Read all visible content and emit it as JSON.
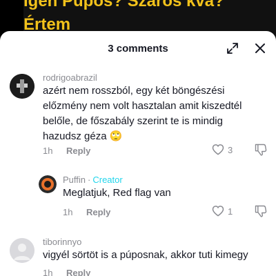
{
  "background": {
    "caption_line1": "Igen Pupos? Szaros kva?",
    "caption_line2": "Értem"
  },
  "sheet": {
    "title": "3 comments"
  },
  "comments": [
    {
      "username": "rodrigoabrazil",
      "text": "azért nem rosszból, egy két böngészési előzmény nem volt hasztalan amit kiszedtél belőle, de főszabály szerint te is mindig hazudsz géza 🙄",
      "time": "1h",
      "reply_label": "Reply",
      "likes": "3"
    },
    {
      "username": "Puffin",
      "creator_label": "Creator",
      "separator": "·",
      "text": "Meglatjuk, Red flag van",
      "time": "1h",
      "reply_label": "Reply",
      "likes": "1"
    },
    {
      "username": "tiborinnyo",
      "text": "vigyél sörtöt is a púposnak, akkor tuti kimegy",
      "time": "1h",
      "reply_label": "Reply"
    }
  ],
  "colors": {
    "caption": "#f2c21b",
    "creator": "#20d5ec",
    "text": "#161823",
    "muted": "#8a8b91"
  }
}
